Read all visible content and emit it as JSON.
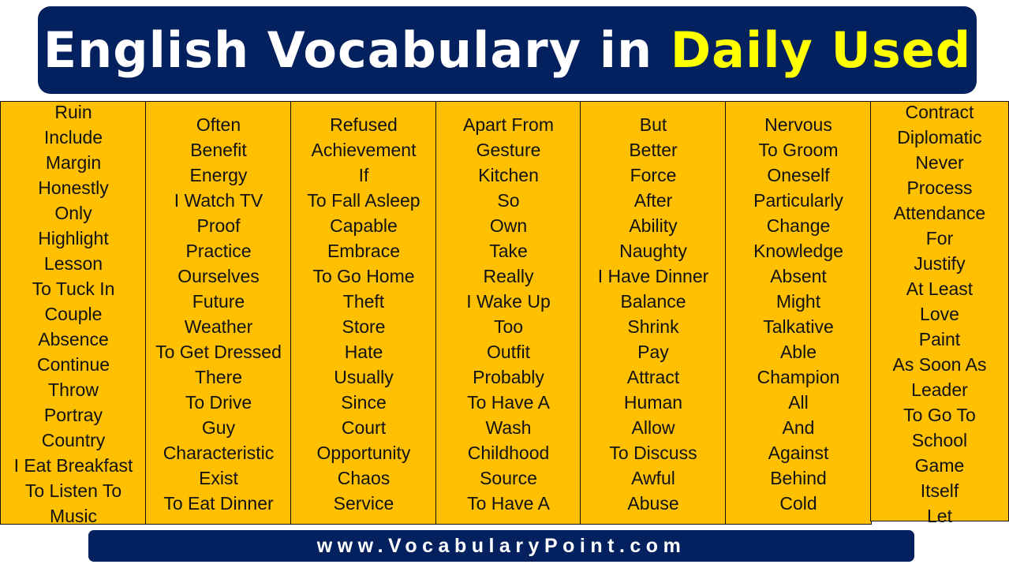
{
  "header": {
    "title_white": "English Vocabulary in",
    "title_highlight": "Daily Used",
    "colors": {
      "banner": "#03215e",
      "title": "#ffffff",
      "highlight": "#ffff00",
      "cell": "#fec000"
    }
  },
  "columns": [
    [
      "Ruin",
      "Include",
      "Margin",
      "Honestly",
      "Only",
      "Highlight",
      "Lesson",
      "To Tuck In",
      "Couple",
      "Absence",
      "Continue",
      "Throw",
      "Portray",
      "Country",
      "I Eat Breakfast",
      "To Listen To",
      "Music"
    ],
    [
      "Often",
      "Benefit",
      "Energy",
      "I Watch TV",
      "Proof",
      "Practice",
      "Ourselves",
      "Future",
      "Weather",
      "To Get Dressed",
      "There",
      "To Drive",
      "Guy",
      "Characteristic",
      "Exist",
      "To Eat Dinner"
    ],
    [
      "Refused",
      "Achievement",
      "If",
      "To Fall Asleep",
      "Capable",
      "Embrace",
      "To Go Home",
      "Theft",
      "Store",
      "Hate",
      "Usually",
      "Since",
      "Court",
      "Opportunity",
      "Chaos",
      "Service"
    ],
    [
      "Apart From",
      "Gesture",
      "Kitchen",
      "So",
      "Own",
      "Take",
      "Really",
      "I Wake Up",
      "Too",
      "Outfit",
      "Probably",
      "To Have A",
      "Wash",
      "Childhood",
      "Source",
      "To Have A"
    ],
    [
      "But",
      "Better",
      "Force",
      "After",
      "Ability",
      "Naughty",
      "I Have Dinner",
      "Balance",
      "Shrink",
      "Pay",
      "Attract",
      "Human",
      "Allow",
      "To Discuss",
      "Awful",
      "Abuse"
    ],
    [
      "Nervous",
      "To Groom",
      "Oneself",
      "Particularly",
      "Change",
      "Knowledge",
      "Absent",
      "Might",
      "Talkative",
      "Able",
      "Champion",
      "All",
      "And",
      "Against",
      "Behind",
      "Cold"
    ],
    [
      "Contract",
      "Diplomatic",
      "Never",
      "Process",
      "Attendance",
      "For",
      "Justify",
      "At Least",
      "Love",
      "Paint",
      "As Soon As",
      "Leader",
      "To Go To",
      "School",
      "Game",
      "Itself",
      "Let"
    ]
  ],
  "footer": {
    "website": "www.VocabularyPoint.com"
  }
}
